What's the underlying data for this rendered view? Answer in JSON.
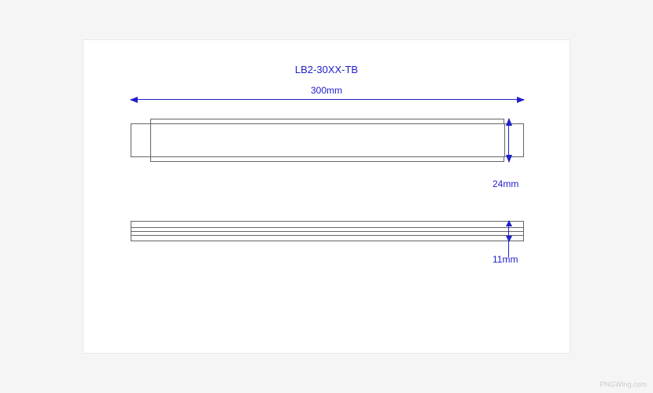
{
  "part_number": "LB2-30XX-TB",
  "dimensions": {
    "width": "300mm",
    "height_front": "24mm",
    "height_top": "11mm"
  },
  "watermark": "PNGWing.com"
}
